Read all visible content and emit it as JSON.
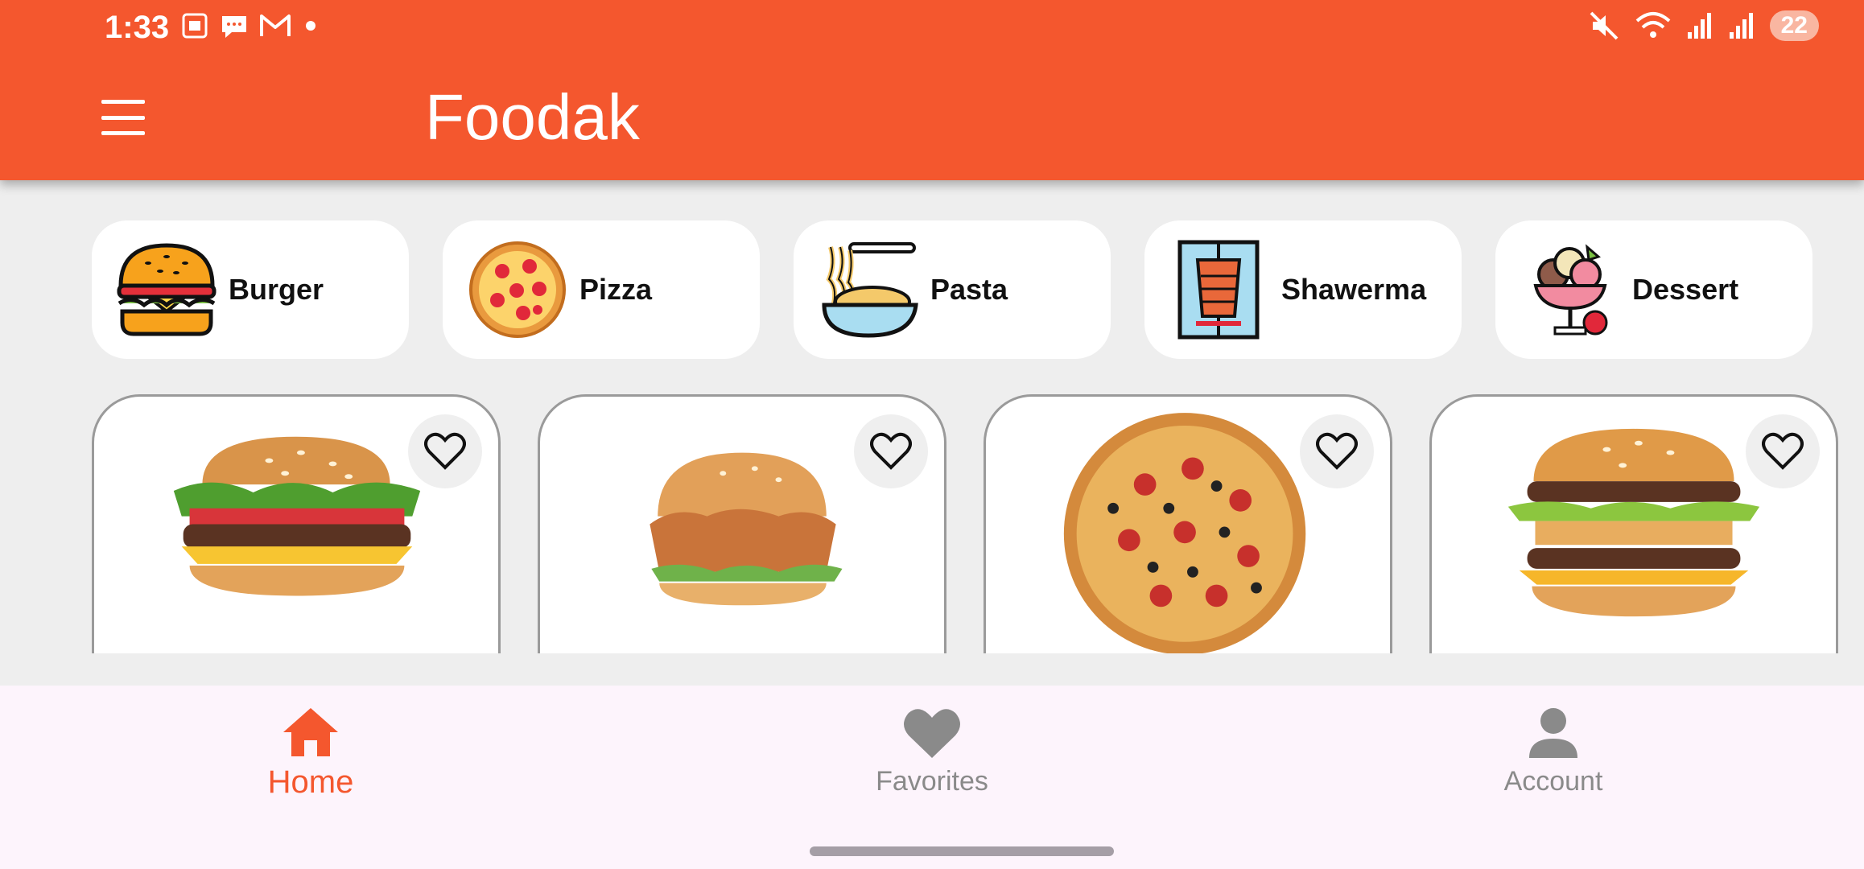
{
  "status_bar": {
    "time": "1:33",
    "left_icons": [
      "screenshot-icon",
      "chat-bubble-icon",
      "gmail-icon",
      "dot-icon"
    ],
    "right_icons": [
      "mute-icon",
      "wifi-icon",
      "signal-icon",
      "signal-icon"
    ],
    "battery": "22"
  },
  "app_bar": {
    "menu_icon": "hamburger-menu-icon",
    "title": "Foodak"
  },
  "categories": [
    {
      "label": "Burger",
      "icon": "burger-icon"
    },
    {
      "label": "Pizza",
      "icon": "pizza-icon"
    },
    {
      "label": "Pasta",
      "icon": "pasta-icon"
    },
    {
      "label": "Shawerma",
      "icon": "shawerma-icon"
    },
    {
      "label": "Dessert",
      "icon": "dessert-icon"
    }
  ],
  "products": [
    {
      "image": "cheeseburger-image",
      "favorite_icon": "heart-outline-icon"
    },
    {
      "image": "chicken-burger-image",
      "favorite_icon": "heart-outline-icon"
    },
    {
      "image": "pizza-image",
      "favorite_icon": "heart-outline-icon"
    },
    {
      "image": "double-burger-image",
      "favorite_icon": "heart-outline-icon"
    }
  ],
  "bottom_nav": {
    "items": [
      {
        "label": "Home",
        "icon": "home-icon",
        "active": true
      },
      {
        "label": "Favorites",
        "icon": "heart-icon",
        "active": false
      },
      {
        "label": "Account",
        "icon": "person-icon",
        "active": false
      }
    ]
  },
  "colors": {
    "primary": "#f4572e",
    "background": "#eeeeee",
    "nav_background": "#fdf4fc",
    "inactive": "#8a8a8a"
  }
}
